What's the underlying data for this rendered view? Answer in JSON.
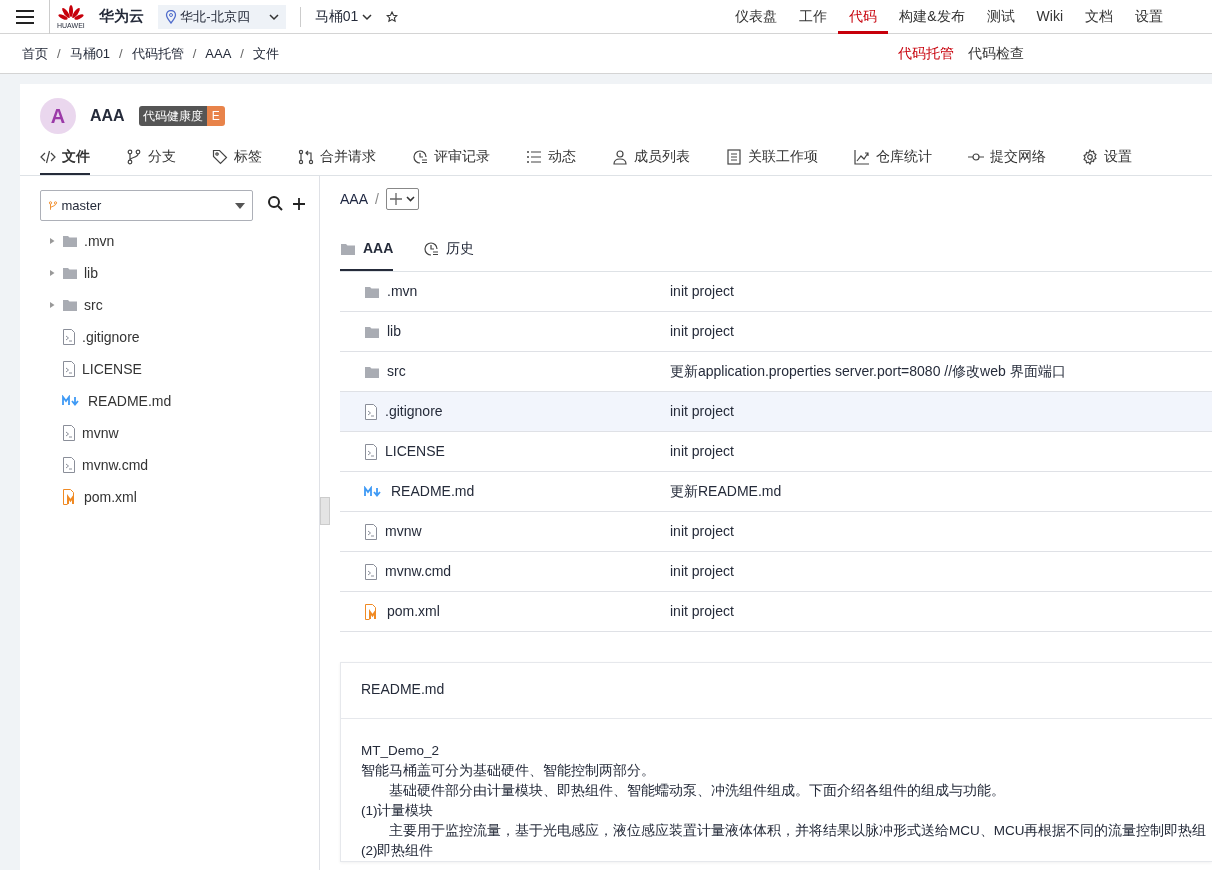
{
  "topbar": {
    "logo_text": "HUAWEI",
    "brand": "华为云",
    "region": "华北-北京四",
    "project": "马桶01",
    "nav": [
      {
        "label": "仪表盘",
        "selected": false
      },
      {
        "label": "工作",
        "selected": false
      },
      {
        "label": "代码",
        "selected": true
      },
      {
        "label": "构建&发布",
        "selected": false
      },
      {
        "label": "测试",
        "selected": false
      },
      {
        "label": "Wiki",
        "selected": false
      },
      {
        "label": "文档",
        "selected": false
      },
      {
        "label": "设置",
        "selected": false
      }
    ]
  },
  "breadcrumb": [
    {
      "kind": "link",
      "text": "首页"
    },
    {
      "kind": "separator",
      "text": "/"
    },
    {
      "kind": "link",
      "text": "马桶01"
    },
    {
      "kind": "separator",
      "text": "/"
    },
    {
      "kind": "link",
      "text": "代码托管"
    },
    {
      "kind": "separator",
      "text": "/"
    },
    {
      "kind": "link",
      "text": "AAA"
    },
    {
      "kind": "separator",
      "text": "/"
    },
    {
      "kind": "link",
      "text": "文件"
    }
  ],
  "subnav": [
    {
      "label": "代码托管",
      "selected": true
    },
    {
      "label": "代码检查",
      "selected": false
    }
  ],
  "repo": {
    "avatar": "A",
    "name": "AAA",
    "health_label": "代码健康度",
    "health_grade": "E"
  },
  "tabs": [
    {
      "label": "文件",
      "selected": true
    },
    {
      "label": "分支",
      "selected": false
    },
    {
      "label": "标签",
      "selected": false
    },
    {
      "label": "合并请求",
      "selected": false
    },
    {
      "label": "评审记录",
      "selected": false
    },
    {
      "label": "动态",
      "selected": false
    },
    {
      "label": "成员列表",
      "selected": false
    },
    {
      "label": "关联工作项",
      "selected": false
    },
    {
      "label": "仓库统计",
      "selected": false
    },
    {
      "label": "提交网络",
      "selected": false
    },
    {
      "label": "设置",
      "selected": false
    }
  ],
  "sidebar": {
    "branch": "master",
    "tree": [
      {
        "name": ".mvn",
        "kind": "folder",
        "expanded": false
      },
      {
        "name": "lib",
        "kind": "folder",
        "expanded": false
      },
      {
        "name": "src",
        "kind": "folder",
        "expanded": false
      },
      {
        "name": ".gitignore",
        "kind": "file"
      },
      {
        "name": "LICENSE",
        "kind": "file"
      },
      {
        "name": "README.md",
        "kind": "markdown"
      },
      {
        "name": "mvnw",
        "kind": "file"
      },
      {
        "name": "mvnw.cmd",
        "kind": "file"
      },
      {
        "name": "pom.xml",
        "kind": "maven"
      }
    ]
  },
  "path": [
    {
      "kind": "link",
      "text": "AAA"
    },
    {
      "kind": "separator",
      "text": "/"
    }
  ],
  "view_tabs": [
    {
      "label": "AAA",
      "selected": true
    },
    {
      "label": "历史",
      "selected": false
    }
  ],
  "files": [
    {
      "name": ".mvn",
      "kind": "folder",
      "message": "init project",
      "highlighted": false
    },
    {
      "name": "lib",
      "kind": "folder",
      "message": "init project",
      "highlighted": false
    },
    {
      "name": "src",
      "kind": "folder",
      "message": "更新application.properties server.port=8080 //修改web 界面端口",
      "highlighted": false
    },
    {
      "name": ".gitignore",
      "kind": "file",
      "message": "init project",
      "highlighted": true
    },
    {
      "name": "LICENSE",
      "kind": "file",
      "message": "init project",
      "highlighted": false
    },
    {
      "name": "README.md",
      "kind": "markdown",
      "message": "更新README.md",
      "highlighted": false
    },
    {
      "name": "mvnw",
      "kind": "file",
      "message": "init project",
      "highlighted": false
    },
    {
      "name": "mvnw.cmd",
      "kind": "file",
      "message": "init project",
      "highlighted": false
    },
    {
      "name": "pom.xml",
      "kind": "maven",
      "message": "init project",
      "highlighted": false
    }
  ],
  "readme": {
    "title": "README.md",
    "lines": [
      {
        "kind": "plain",
        "text": "MT_Demo_2"
      },
      {
        "kind": "plain",
        "text": "智能马桶盖可分为基础硬件、智能控制两部分。"
      },
      {
        "kind": "indent",
        "text": "基础硬件部分由计量模块、即热组件、智能蠕动泵、冲洗组件组成。下面介绍各组件的组成与功能。"
      },
      {
        "kind": "plain",
        "text": "(1)计量模块"
      },
      {
        "kind": "indent",
        "text": "主要用于监控流量，基于光电感应，液位感应装置计量液体体积，并将结果以脉冲形式送给MCU、MCU再根据不同的流量控制即热组"
      },
      {
        "kind": "plain",
        "text": "(2)即热组件"
      }
    ]
  }
}
